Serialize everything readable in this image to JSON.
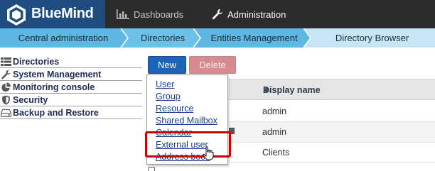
{
  "brand": {
    "name": "BlueMind"
  },
  "topnav": {
    "dashboards": "Dashboards",
    "administration": "Administration"
  },
  "breadcrumb": [
    "Central administration",
    "Directories",
    "Entities Management",
    "Directory Browser"
  ],
  "sidebar": {
    "items": [
      {
        "label": "Directories",
        "icon": "list-icon"
      },
      {
        "label": "System Management",
        "icon": "wrench-icon"
      },
      {
        "label": "Monitoring console",
        "icon": "pie-chart-icon"
      },
      {
        "label": "Security",
        "icon": "shield-icon"
      },
      {
        "label": "Backup and Restore",
        "icon": "drive-icon"
      }
    ]
  },
  "toolbar": {
    "new_label": "New",
    "delete_label": "Delete"
  },
  "table": {
    "header_display_name": "Display name",
    "rows": [
      {
        "display_name": "admin"
      },
      {
        "display_name": "admin"
      },
      {
        "display_name": "Clients"
      }
    ]
  },
  "new_menu": {
    "items": [
      "User",
      "Group",
      "Resource",
      "Shared Mailbox",
      "Calendar",
      "External user",
      "Address book"
    ]
  },
  "colors": {
    "brand_blue": "#1f4d80",
    "topbar": "#2c2c2c",
    "breadcrumb": "#c6e6f5",
    "new_button": "#1d63b8",
    "delete_button": "#d88b8f",
    "highlight": "#cc0000"
  }
}
